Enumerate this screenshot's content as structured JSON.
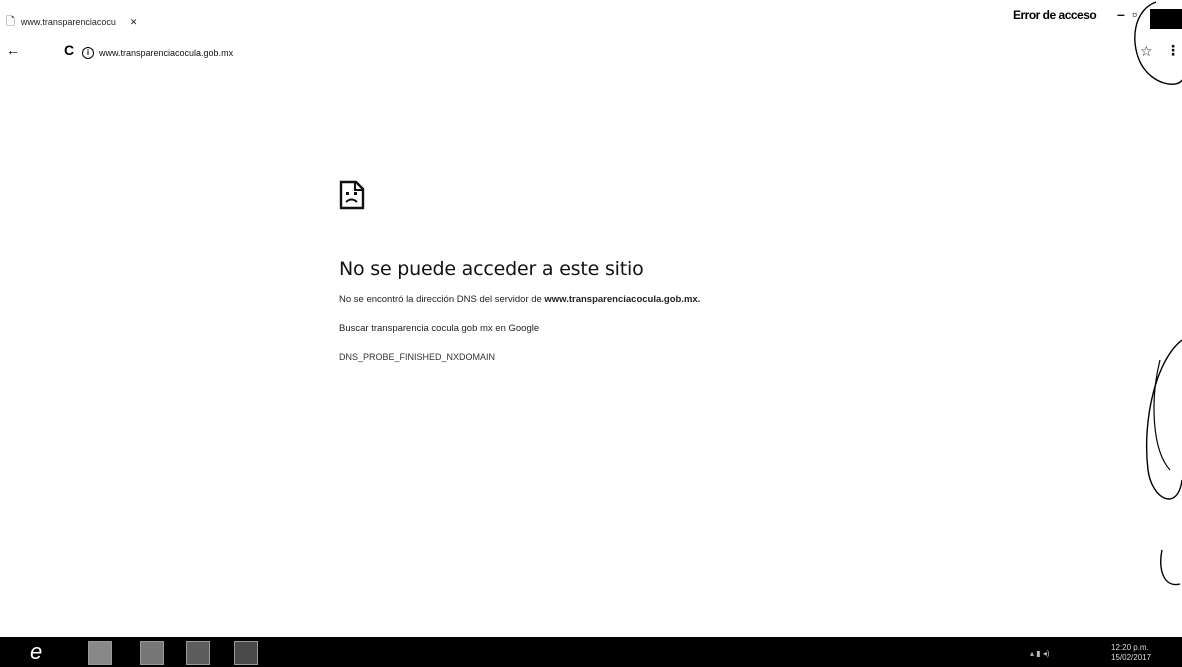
{
  "browser": {
    "tab_title": "www.transparenciacocu",
    "window_title": "Error de acceso",
    "url": "www.transparenciacocula.gob.mx"
  },
  "error_page": {
    "title": "No se puede acceder a este sitio",
    "dns_message_prefix": "No se encontró la dirección DNS del servidor de",
    "dns_host": "www.transparenciacocula.gob.mx.",
    "search_suggestion": "Buscar transparencia cocula gob mx en Google",
    "error_code": "DNS_PROBE_FINISHED_NXDOMAIN"
  },
  "taskbar": {
    "clock_time": "12:20 p.m.",
    "clock_date": "15/02/2017"
  },
  "icons": {
    "tab_favicon": "page-icon",
    "back": "back-arrow-icon",
    "reload": "reload-icon",
    "site_info": "info-icon",
    "bookmark": "star-icon",
    "menu": "kebab-menu-icon",
    "error": "sad-page-icon",
    "ie": "internet-explorer-icon"
  }
}
